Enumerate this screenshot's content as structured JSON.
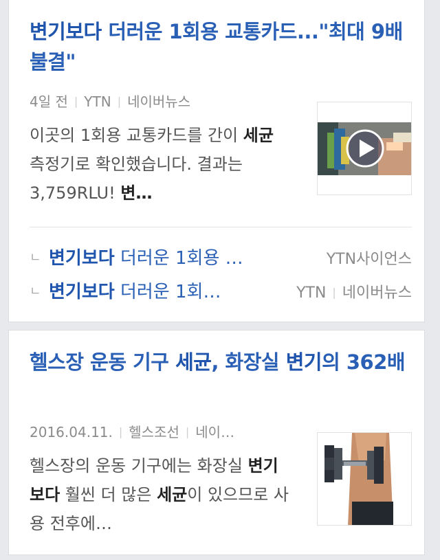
{
  "articles": [
    {
      "title_highlight": "변기보다",
      "title_rest": " 더러운 1회용 교통카드...\"최대 9배 불결\"",
      "meta": {
        "date": "4일 전",
        "source": "YTN",
        "portal": "네이버뉴스"
      },
      "snippet_pre": "이곳의 1회용 교통카드를 간이 ",
      "snippet_bold1": "세균",
      "snippet_mid": " 측정기로 확인했습니다. 결과는 3,759RLU! ",
      "snippet_bold2": "변…",
      "thumbnail": {
        "type": "video",
        "icon": "play-icon"
      },
      "related": [
        {
          "highlight": "변기보다",
          "rest": " 더러운 1회용 …",
          "source": "YTN사이언스"
        },
        {
          "highlight": "변기보다",
          "rest": " 더러운 1회…",
          "source": "YTN",
          "portal": "네이버뉴스"
        }
      ]
    },
    {
      "title_part1": "헬스장 운동 기구 ",
      "title_bold1": "세균",
      "title_part2": ", 화장실 ",
      "title_bold2": "변기",
      "title_part3": "의 362배",
      "meta": {
        "date": "2016.04.11.",
        "source": "헬스조선",
        "portal": "네이…"
      },
      "snippet_pre": "헬스장의 운동 기구에는 화장실 ",
      "snippet_bold1": "변기보다",
      "snippet_mid": " 훨씬 더 많은 ",
      "snippet_bold2": "세균",
      "snippet_post": "이 있으므로 사용 전후에…",
      "thumbnail": {
        "type": "photo",
        "icon": "dumbbell-icon"
      }
    }
  ],
  "colors": {
    "link": "#2a5fb6",
    "meta": "#8a8a8a",
    "background": "#e8e9ec"
  }
}
